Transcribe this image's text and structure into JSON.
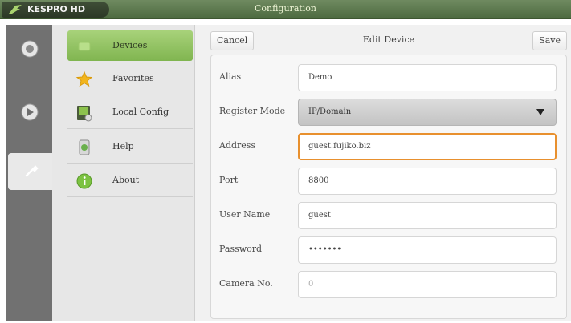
{
  "app": {
    "name": "KESPRO HD",
    "window_title": "Configuration"
  },
  "rail": {
    "items": [
      {
        "name": "record",
        "icon": "record-icon"
      },
      {
        "name": "play",
        "icon": "play-icon"
      },
      {
        "name": "settings",
        "icon": "wrench-icon",
        "active": true
      }
    ]
  },
  "menu": {
    "items": [
      {
        "label": "Devices",
        "icon": "devices-icon",
        "active": true
      },
      {
        "label": "Favorites",
        "icon": "star-icon"
      },
      {
        "label": "Local Config",
        "icon": "local-config-icon"
      },
      {
        "label": "Help",
        "icon": "help-icon"
      },
      {
        "label": "About",
        "icon": "about-icon"
      }
    ]
  },
  "toolbar": {
    "cancel_label": "Cancel",
    "title": "Edit Device",
    "save_label": "Save"
  },
  "form": {
    "fields": [
      {
        "label": "Alias",
        "value": "Demo"
      },
      {
        "label": "Register Mode",
        "value": "IP/Domain"
      },
      {
        "label": "Address",
        "value": "guest.fujiko.biz"
      },
      {
        "label": "Port",
        "value": "8800"
      },
      {
        "label": "User Name",
        "value": "guest"
      },
      {
        "label": "Password",
        "value": "•••••••"
      },
      {
        "label": "Camera No.",
        "value": "0"
      }
    ]
  },
  "colors": {
    "titlebar": "#5a7a4a",
    "menu_active": "#8fc05e",
    "focus_border": "#e8902e"
  }
}
